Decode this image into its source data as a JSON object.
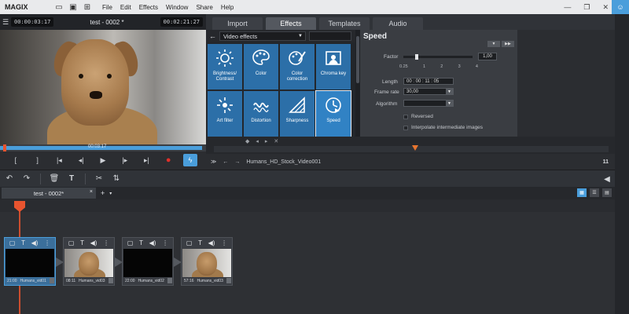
{
  "app": {
    "logo": "MAGIX",
    "menu": [
      "File",
      "Edit",
      "Effects",
      "Window",
      "Share",
      "Help"
    ],
    "icons": [
      "folder-icon",
      "save-icon",
      "new-project-icon",
      "minimize-icon",
      "restore-icon",
      "close-icon",
      "user-icon"
    ]
  },
  "preview": {
    "timecode_left": "00:00:03:17",
    "title": "test - 0002 *",
    "timecode_right": "00:02:21:27",
    "scrub_time": "00:03:17",
    "scrub_progress": 0.98,
    "transport": [
      "mark-in-icon",
      "mark-out-icon",
      "jump-start-icon",
      "prev-frame-icon",
      "play-icon",
      "next-frame-icon",
      "jump-end-icon",
      "record-icon",
      "live-icon"
    ]
  },
  "media_pool": {
    "tabs": [
      "Import",
      "Effects",
      "Templates",
      "Audio"
    ],
    "active_tab": "Effects",
    "category": "Video effects",
    "effects": [
      {
        "label": "Brightness/ Contrast",
        "icon": "brightness-icon"
      },
      {
        "label": "Color",
        "icon": "palette-icon"
      },
      {
        "label": "Color correction",
        "icon": "color-correction-icon"
      },
      {
        "label": "Chroma key",
        "icon": "chroma-key-icon"
      },
      {
        "label": "Art filter",
        "icon": "art-filter-icon"
      },
      {
        "label": "Distortion",
        "icon": "distortion-icon"
      },
      {
        "label": "Sharpness",
        "icon": "sharpness-icon"
      },
      {
        "label": "Speed",
        "icon": "speed-icon"
      }
    ],
    "selected_effect": "Speed",
    "path_clip": "Humans_HD_Stock_Video001",
    "path_right": "11"
  },
  "speed": {
    "title": "Speed",
    "factor_label": "Factor",
    "factor_value": "1,00",
    "ticks": [
      "0.25",
      "1",
      "2",
      "3",
      "4"
    ],
    "length_label": "Length",
    "length_value": "00 : 00 : 11 : 05",
    "framerate_label": "Frame rate",
    "framerate_value": "30,00",
    "algorithm_label": "Algorithm",
    "algorithm_value": "",
    "reversed_label": "Reversed",
    "interpolate_label": "Interpolate intermediate images"
  },
  "toolbar": {
    "tools": [
      "undo-icon",
      "redo-icon",
      "delete-icon",
      "title-icon",
      "cut-icon",
      "split-icon"
    ]
  },
  "project": {
    "tab": "test - 0002*",
    "add": "+",
    "dropdown": "▾"
  },
  "timeline": {
    "clips": [
      {
        "id": 1,
        "start": "21:00",
        "name": "Humans_vid01",
        "thumb": "black",
        "selected": true
      },
      {
        "id": 2,
        "start": "08:11",
        "name": "Humans_vid03",
        "thumb": "dog",
        "selected": false
      },
      {
        "id": 3,
        "start": "22:00",
        "name": "Humans_vid02",
        "thumb": "black",
        "selected": false
      },
      {
        "id": 4,
        "start": "57:16",
        "name": "Humans_vid03",
        "thumb": "dog",
        "selected": false
      }
    ]
  },
  "colors": {
    "accent": "#4a9edb",
    "effect_tile": "#2c6fa8",
    "playhead": "#e8542f",
    "record": "#e0302a"
  }
}
